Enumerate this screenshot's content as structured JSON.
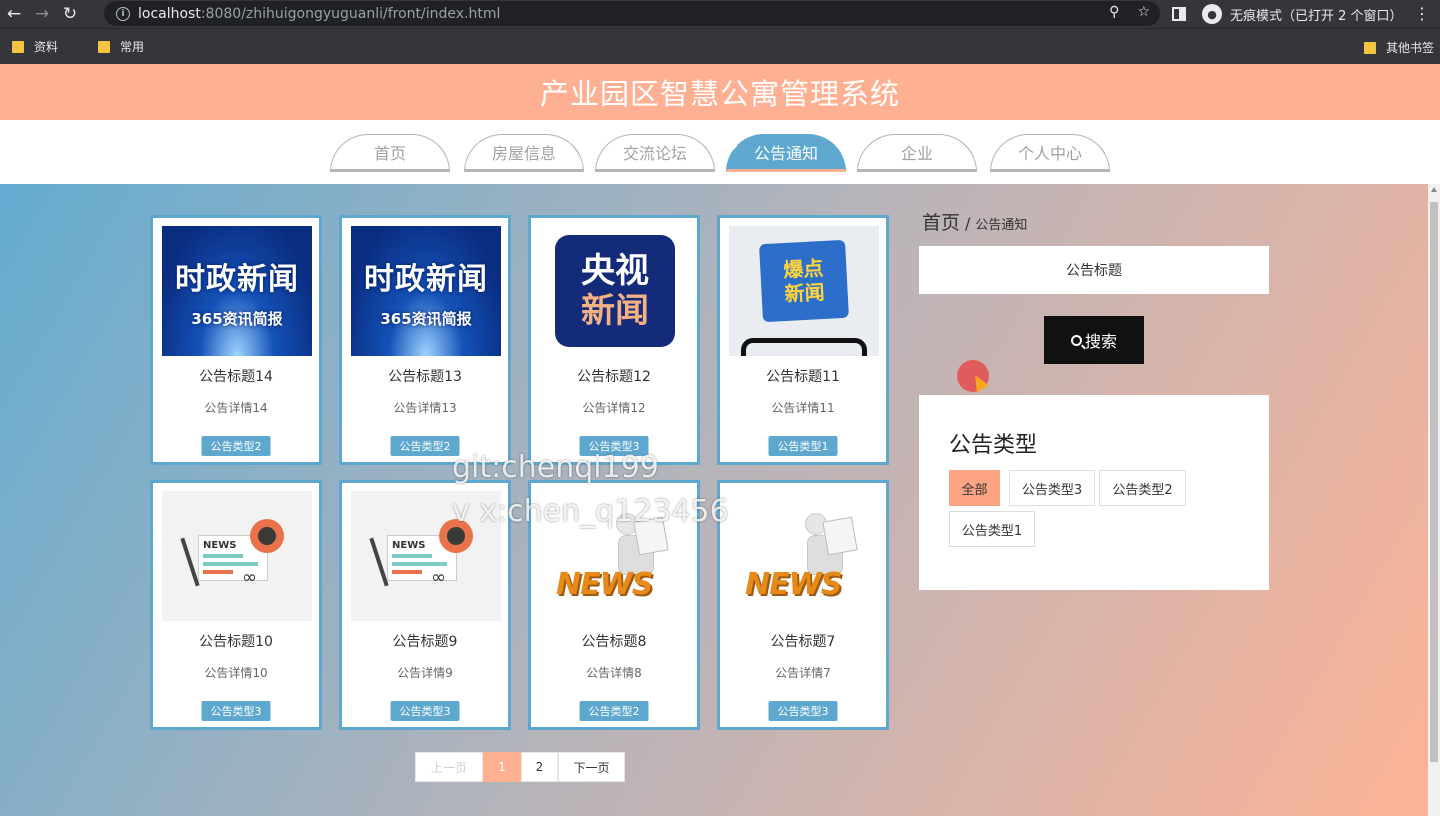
{
  "browser": {
    "url_host": "localhost",
    "url_path": ":8080/zhihuigongyuguanli/front/index.html",
    "incognito_label": "无痕模式（已打开 2 个窗口）",
    "bookmarks": [
      "资料",
      "常用"
    ],
    "other_bookmarks": "其他书签"
  },
  "site": {
    "title": "产业园区智慧公寓管理系统",
    "nav": [
      "首页",
      "房屋信息",
      "交流论坛",
      "公告通知",
      "企业",
      "个人中心"
    ],
    "active_nav": "公告通知"
  },
  "cards": [
    {
      "title": "公告标题14",
      "desc": "公告详情14",
      "type": "公告类型2",
      "image": "时政新闻 365资讯简报"
    },
    {
      "title": "公告标题13",
      "desc": "公告详情13",
      "type": "公告类型2",
      "image": "时政新闻 365资讯简报"
    },
    {
      "title": "公告标题12",
      "desc": "公告详情12",
      "type": "公告类型3",
      "image": "央视新闻"
    },
    {
      "title": "公告标题11",
      "desc": "公告详情11",
      "type": "公告类型1",
      "image": "爆点新闻"
    },
    {
      "title": "公告标题10",
      "desc": "公告详情10",
      "type": "公告类型3",
      "image": "NEWS newspaper"
    },
    {
      "title": "公告标题9",
      "desc": "公告详情9",
      "type": "公告类型3",
      "image": "NEWS newspaper"
    },
    {
      "title": "公告标题8",
      "desc": "公告详情8",
      "type": "公告类型2",
      "image": "NEWS 3d figure"
    },
    {
      "title": "公告标题7",
      "desc": "公告详情7",
      "type": "公告类型3",
      "image": "NEWS 3d figure"
    }
  ],
  "card_image_text": {
    "shizheng_big": "时政新闻",
    "shizheng_small": "365资讯简报",
    "cctv_line1": "央视",
    "cctv_line2": "新闻",
    "baodian_line1": "爆点",
    "baodian_line2": "新闻",
    "news_word": "NEWS"
  },
  "sidebar": {
    "breadcrumb_home": "首页",
    "breadcrumb_sep": "/",
    "breadcrumb_current": "公告通知",
    "search_placeholder": "公告标题",
    "search_button": "搜索",
    "type_panel_title": "公告类型",
    "types": [
      "全部",
      "公告类型3",
      "公告类型2",
      "公告类型1"
    ],
    "active_type": "全部"
  },
  "pagination": {
    "prev": "上一页",
    "pages": [
      "1",
      "2"
    ],
    "current": "1",
    "next": "下一页"
  },
  "watermark": {
    "line1": "git:chenqi199",
    "line2": "v x:chen_q123456"
  },
  "colors": {
    "header": "#ffb092",
    "accent_blue": "#5ea8cf",
    "active_type": "#fca484"
  }
}
